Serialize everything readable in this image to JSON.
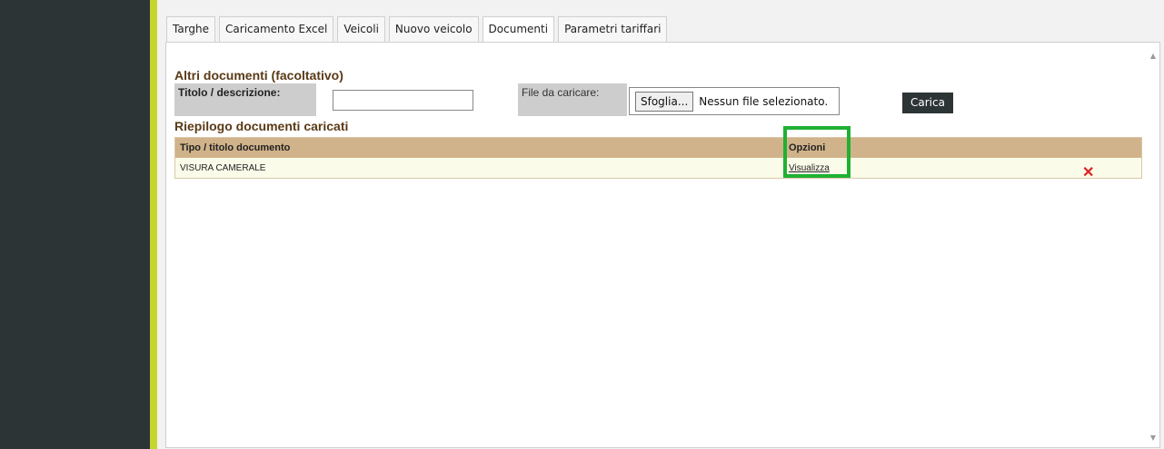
{
  "tabs": [
    {
      "label": "Targhe",
      "active": false
    },
    {
      "label": "Caricamento Excel",
      "active": false
    },
    {
      "label": "Veicoli",
      "active": false
    },
    {
      "label": "Nuovo veicolo",
      "active": false
    },
    {
      "label": "Documenti",
      "active": true
    },
    {
      "label": "Parametri tariffari",
      "active": false
    }
  ],
  "upload_section": {
    "title": "Altri documenti (facoltativo)",
    "description_label": "Titolo / descrizione:",
    "description_value": "",
    "file_label": "File da caricare:",
    "browse_label": "Sfoglia...",
    "file_status": "Nessun file selezionato.",
    "upload_button": "Carica"
  },
  "summary_section": {
    "title": "Riepilogo documenti caricati",
    "columns": [
      "Tipo / titolo documento",
      "Opzioni"
    ],
    "rows": [
      {
        "title": "VISURA CAMERALE",
        "action": "Visualizza",
        "delete_icon": "close-icon"
      }
    ]
  },
  "colors": {
    "sidebar": "#2d3436",
    "accent": "#c7d530",
    "table_header": "#d0b38a",
    "highlight": "#1fb132",
    "delete": "#e02020"
  }
}
